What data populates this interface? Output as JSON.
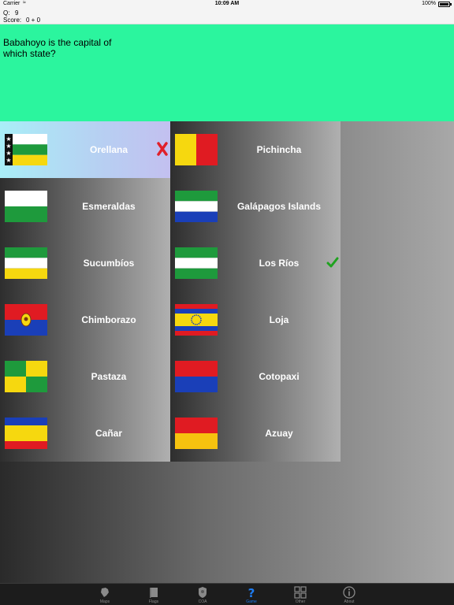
{
  "status_bar": {
    "carrier": "Carrier",
    "time": "10:09 AM",
    "battery": "100%"
  },
  "info": {
    "q_label": "Q:",
    "q_value": "9",
    "score_label": "Score:",
    "score_value": "0 + 0"
  },
  "question": {
    "text": "Babahoyo is the capital of which state?",
    "background_color": "#2bf59e"
  },
  "answers": [
    {
      "label": "Orellana",
      "flag": "orellana-flag",
      "state": "selected-wrong"
    },
    {
      "label": "Pichincha",
      "flag": "pichincha-flag",
      "state": "none"
    },
    {
      "label": "Esmeraldas",
      "flag": "esmeraldas-flag",
      "state": "none"
    },
    {
      "label": "Galápagos Islands",
      "flag": "galapagos-flag",
      "state": "none"
    },
    {
      "label": "Sucumbíos",
      "flag": "sucumbios-flag",
      "state": "none"
    },
    {
      "label": "Los Ríos",
      "flag": "los-rios-flag",
      "state": "correct"
    },
    {
      "label": "Chimborazo",
      "flag": "chimborazo-flag",
      "state": "none"
    },
    {
      "label": "Loja",
      "flag": "loja-flag",
      "state": "none"
    },
    {
      "label": "Pastaza",
      "flag": "pastaza-flag",
      "state": "none"
    },
    {
      "label": "Cotopaxi",
      "flag": "cotopaxi-flag",
      "state": "none"
    },
    {
      "label": "Cañar",
      "flag": "canar-flag",
      "state": "none"
    },
    {
      "label": "Azuay",
      "flag": "azuay-flag",
      "state": "none"
    }
  ],
  "marks": {
    "wrong_icon": "x-mark-icon",
    "wrong_color": "#e0202a",
    "correct_icon": "checkmark-icon",
    "correct_color": "#1fa21f"
  },
  "tabs": [
    {
      "label": "Maps",
      "icon": "map-icon",
      "active": false
    },
    {
      "label": "Flags",
      "icon": "flag-icon",
      "active": false
    },
    {
      "label": "COA",
      "icon": "coat-of-arms-icon",
      "active": false
    },
    {
      "label": "Game",
      "icon": "question-icon",
      "active": true
    },
    {
      "label": "Other",
      "icon": "grid-icon",
      "active": false
    },
    {
      "label": "About",
      "icon": "info-icon",
      "active": false
    }
  ],
  "colors": {
    "accent": "#1d7cf2",
    "tab_bar": "#1c1c1c"
  }
}
